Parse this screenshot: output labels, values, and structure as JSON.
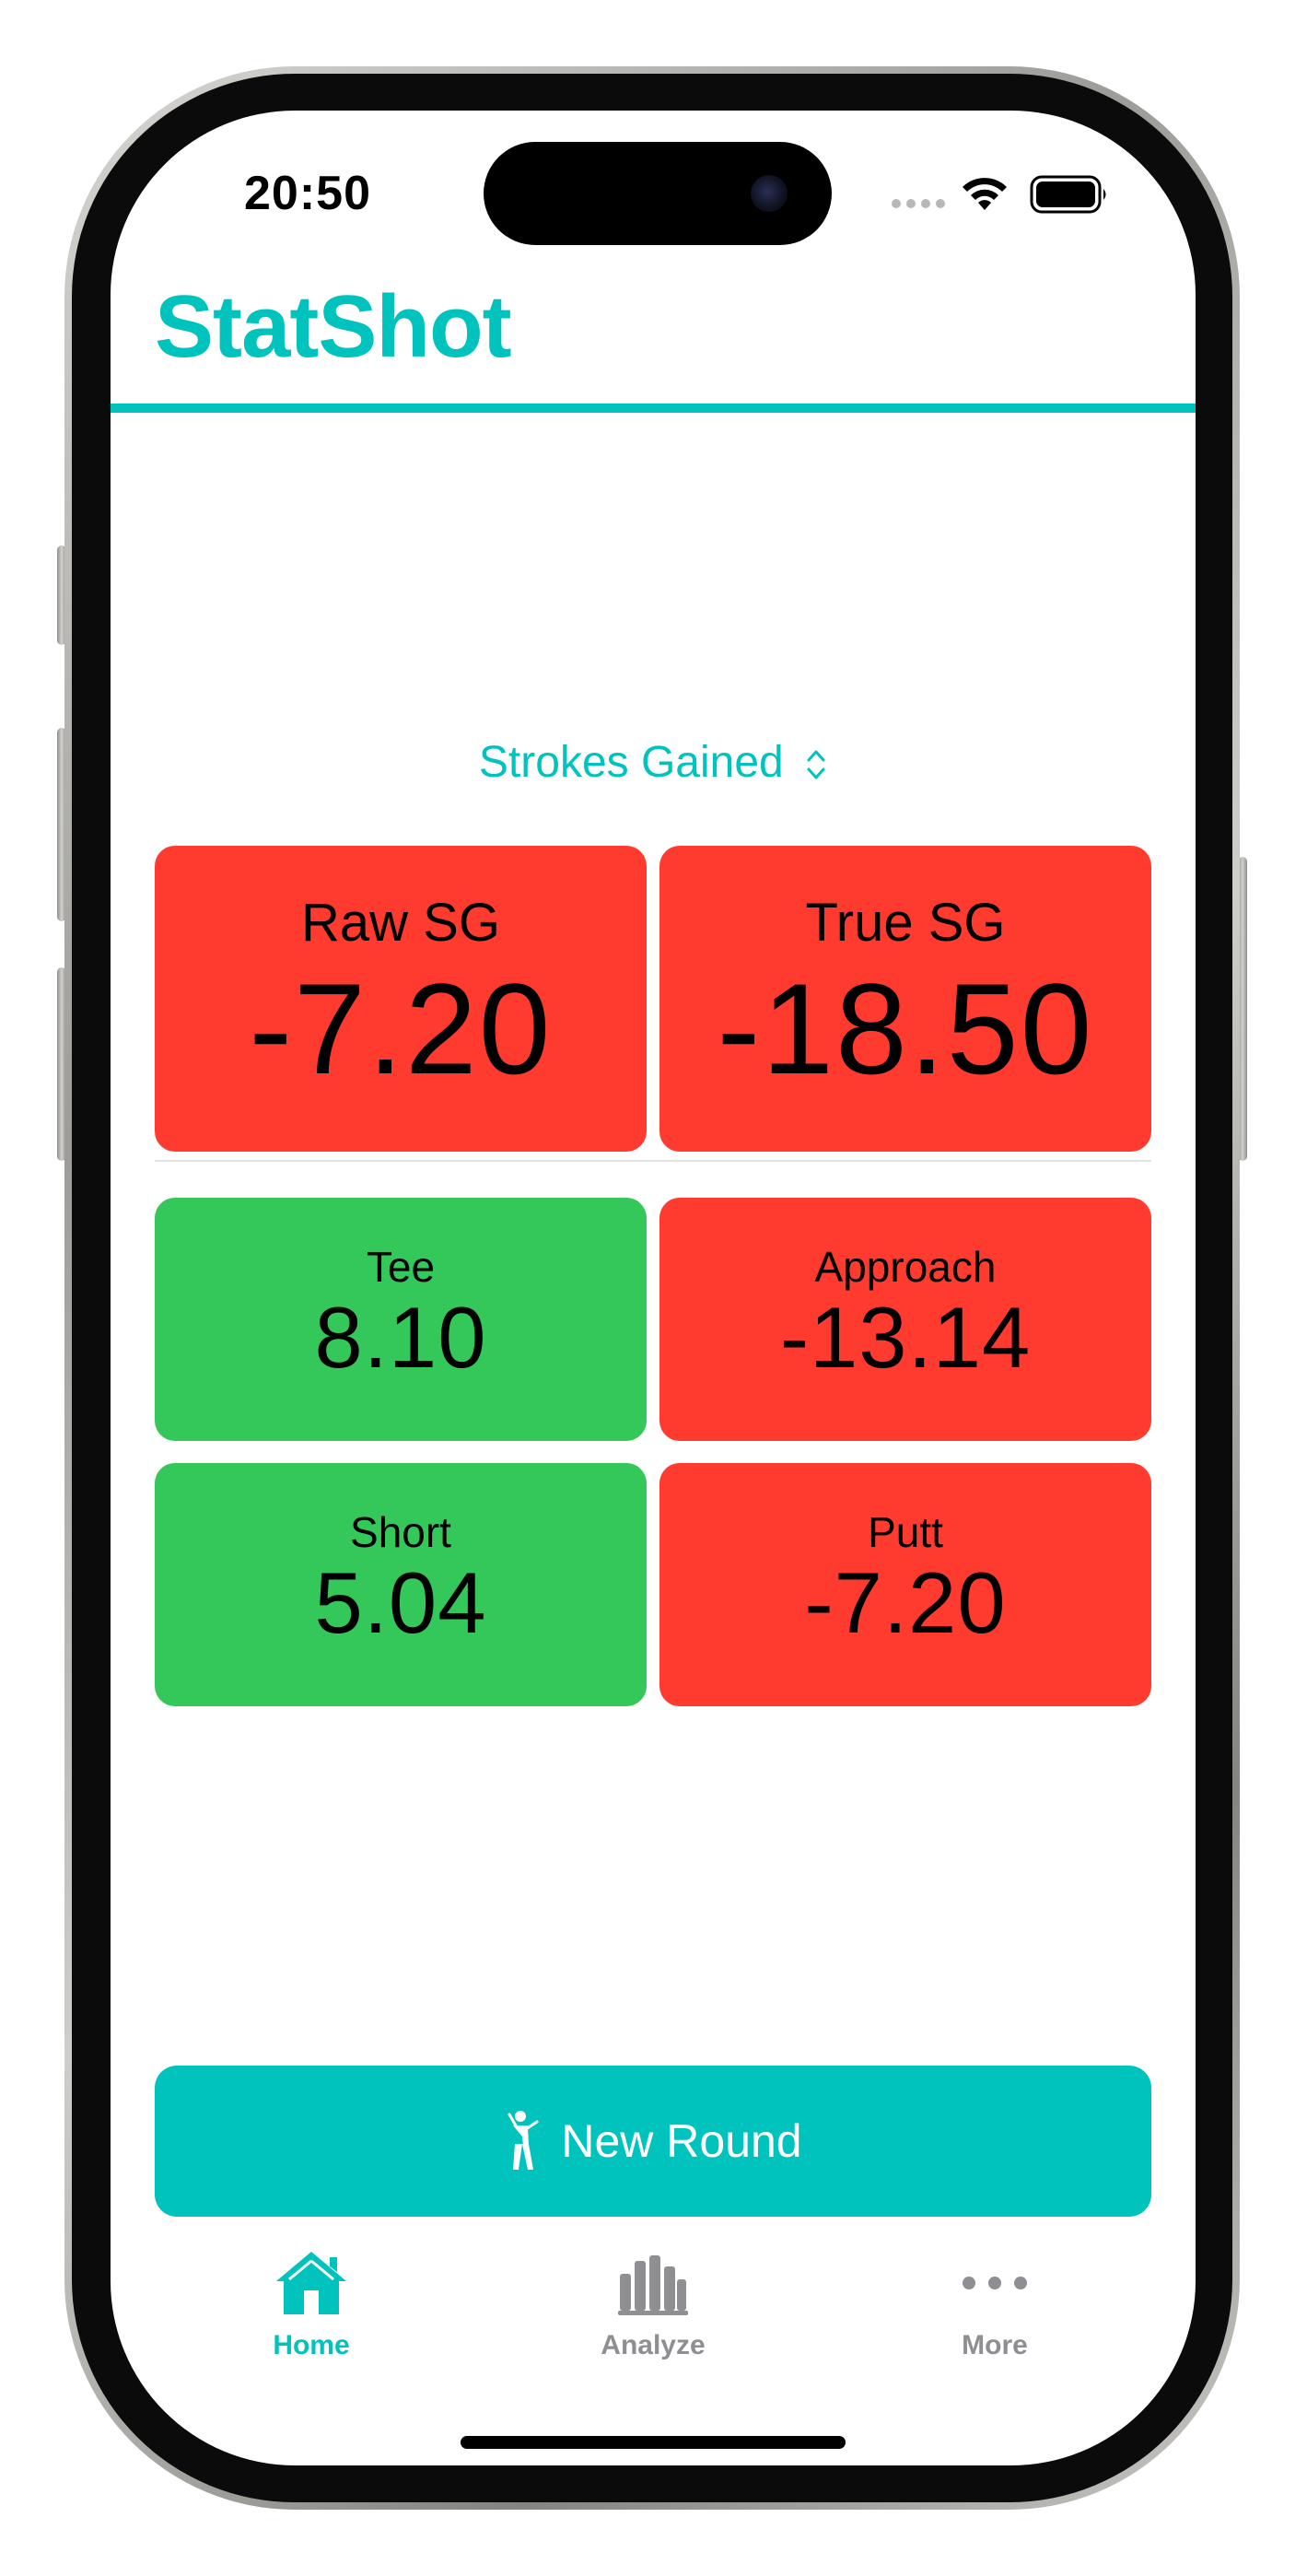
{
  "status_bar": {
    "time": "20:50"
  },
  "app": {
    "title": "StatShot",
    "accent_color": "#00c3bd"
  },
  "selector": {
    "label": "Strokes Gained",
    "icon": "chevron-up-down-icon"
  },
  "summary_tiles": [
    {
      "label": "Raw SG",
      "value": "-7.20",
      "status": "negative",
      "color": "#ff3b30"
    },
    {
      "label": "True SG",
      "value": "-18.50",
      "status": "negative",
      "color": "#ff3b30"
    }
  ],
  "category_tiles": [
    {
      "label": "Tee",
      "value": "8.10",
      "status": "positive",
      "color": "#34c759"
    },
    {
      "label": "Approach",
      "value": "-13.14",
      "status": "negative",
      "color": "#ff3b30"
    },
    {
      "label": "Short",
      "value": "5.04",
      "status": "positive",
      "color": "#34c759"
    },
    {
      "label": "Putt",
      "value": "-7.20",
      "status": "negative",
      "color": "#ff3b30"
    }
  ],
  "primary_action": {
    "label": "New Round",
    "icon": "golfer-icon"
  },
  "tab_bar": {
    "active_color": "#00c3bd",
    "inactive_color": "#8e8e93",
    "tabs": [
      {
        "label": "Home",
        "icon": "house-icon",
        "active": true
      },
      {
        "label": "Analyze",
        "icon": "bar-chart-icon",
        "active": false
      },
      {
        "label": "More",
        "icon": "ellipsis-icon",
        "active": false
      }
    ]
  }
}
